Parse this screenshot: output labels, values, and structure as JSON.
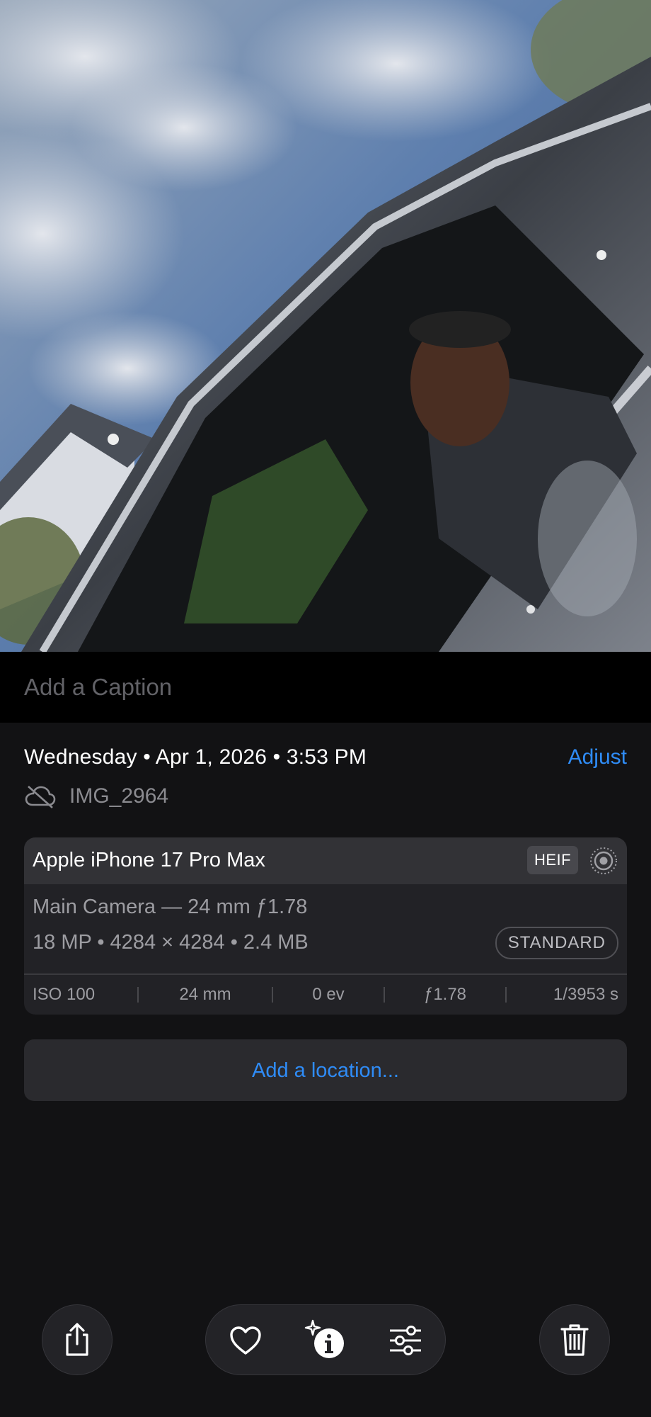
{
  "photo": {
    "alt_icon": "photo-preview"
  },
  "caption": {
    "placeholder": "Add a Caption"
  },
  "info": {
    "date_line": "Wednesday • Apr 1, 2026 • 3:53 PM",
    "adjust_label": "Adjust",
    "filename": "IMG_2964",
    "cloud_icon": "cloud-slash-icon"
  },
  "metadata": {
    "device": "Apple iPhone 17 Pro Max",
    "format_badge": "HEIF",
    "live_icon": "live-photo-icon",
    "lens": "Main Camera — 24 mm ƒ1.78",
    "size": "18 MP • 4284 × 4284 • 2.4 MB",
    "style_badge": "STANDARD",
    "exif": [
      "ISO 100",
      "24 mm",
      "0 ev",
      "ƒ1.78",
      "1/3953 s"
    ]
  },
  "location": {
    "label": "Add a location..."
  },
  "toolbar": {
    "share_icon": "share-icon",
    "favorite_icon": "heart-icon",
    "info_icon": "sparkle-info-icon",
    "edit_icon": "sliders-icon",
    "delete_icon": "trash-icon"
  },
  "colors": {
    "accent": "#2f8cf7",
    "background": "#121214",
    "card": "#222226"
  }
}
